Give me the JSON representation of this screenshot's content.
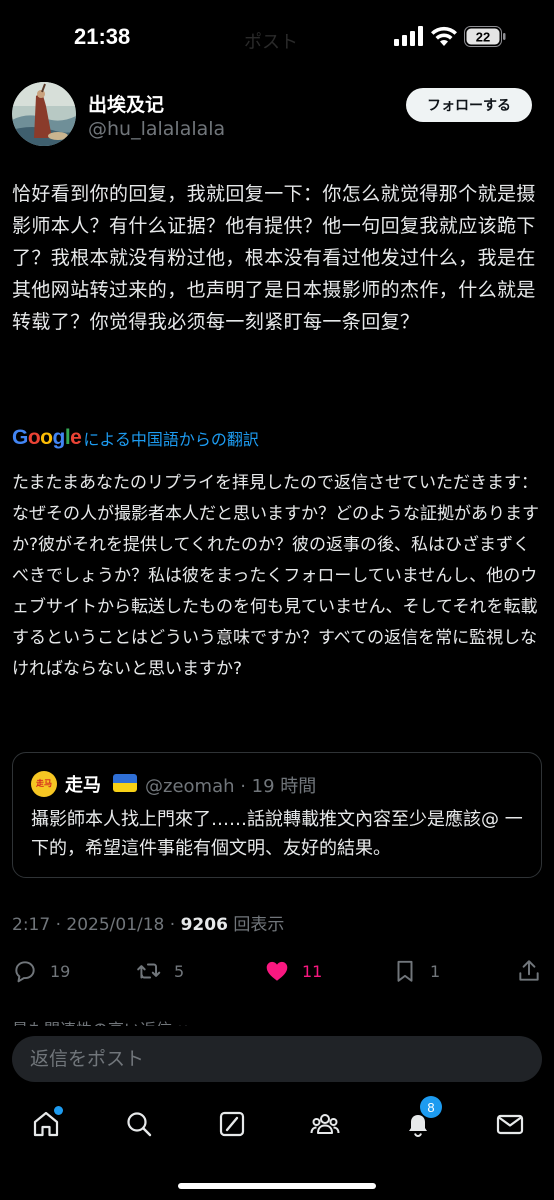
{
  "status_bar": {
    "time": "21:38",
    "ghost_title": "ポスト",
    "battery": "22"
  },
  "author": {
    "display_name": "出埃及记",
    "handle": "@hu_lalalalala",
    "follow_label": "フォローする"
  },
  "post": {
    "text": "恰好看到你的回复，我就回复一下：你怎么就觉得那个就是摄影师本人？有什么证据？他有提供？他一句回复我就应该跪下了？我根本就没有粉过他，根本没有看过他发过什么，我是在其他网站转过来的，也声明了是日本摄影师的杰作，什么就是转载了？你觉得我必须每一刻紧盯每一条回复？"
  },
  "translation": {
    "logo": "Google",
    "logo_colors": [
      "#4285F4",
      "#EA4335",
      "#FBBC05",
      "#4285F4",
      "#34A853",
      "#EA4335"
    ],
    "label": "による中国語からの翻訳",
    "text": "たまたまあなたのリプライを拝見したので返信させていただきます：なぜその人が撮影者本人だと思いますか？どのような証拠がありますか?彼がそれを提供してくれたのか？彼の返事の後、私はひざまずくべきでしょうか？私は彼をまったくフォローしていませんし、他のウェブサイトから転送したものを何も見ていません、そしてそれを転載するということはどういう意味ですか？すべての返信を常に監視しなければならないと思いますか?"
  },
  "quote": {
    "avatar_text": "走马",
    "name": "走马",
    "handle_time": "@zeomah · 19 時間",
    "text": "攝影師本人找上門來了……話說轉載推文內容至少是應該@ 一下的，希望這件事能有個文明、友好的結果。"
  },
  "meta": {
    "time_date": "2:17 · 2025/01/18 · ",
    "views_count": "9206",
    "views_label": " 回表示"
  },
  "actions": {
    "replies": "19",
    "reposts": "5",
    "likes": "11",
    "bookmarks": "1"
  },
  "peek": {
    "text": "最も関連性の高い返信 ∨"
  },
  "reply_box": {
    "placeholder": "返信をポスト"
  },
  "tabbar": {
    "notifications_badge": "8"
  },
  "colors": {
    "accent": "#1d9bf0",
    "like": "#f91880",
    "muted": "#71767b"
  }
}
